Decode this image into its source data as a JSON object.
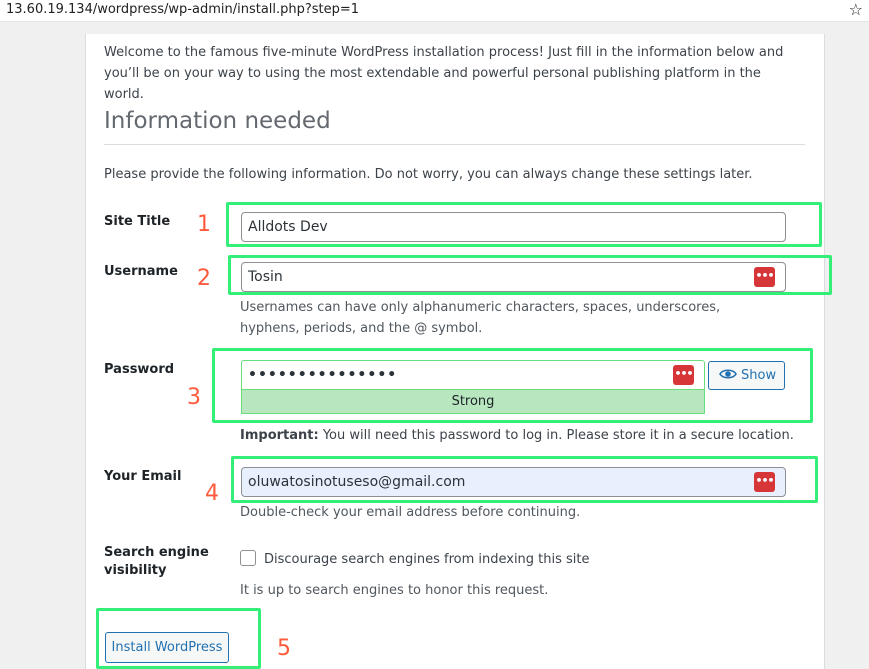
{
  "browser": {
    "url": "13.60.19.134/wordpress/wp-admin/install.php?step=1",
    "bookmark_icon": "star-icon"
  },
  "intro_text": "Welcome to the famous five-minute WordPress installation process! Just fill in the information below and you’ll be on your way to using the most extendable and powerful personal publishing platform in the world.",
  "heading": "Information needed",
  "provide_text": "Please provide the following information. Do not worry, you can always change these settings later.",
  "form": {
    "site_title": {
      "label": "Site Title",
      "value": "Alldots Dev"
    },
    "username": {
      "label": "Username",
      "value": "Tosin",
      "help": "Usernames can have only alphanumeric characters, spaces, underscores, hyphens, periods, and the @ symbol."
    },
    "password": {
      "label": "Password",
      "value": "•••••••••••••••",
      "show_label": "Show",
      "strength": "Strong",
      "important_label": "Important:",
      "important_text": " You will need this password to log in. Please store it in a secure location."
    },
    "email": {
      "label": "Your Email",
      "value": "oluwatosinotuseso@gmail.com",
      "help": "Double-check your email address before continuing."
    },
    "search_engine": {
      "label_line1": "Search engine",
      "label_line2": "visibility",
      "checkbox_label": "Discourage search engines from indexing this site",
      "checked": false,
      "help": "It is up to search engines to honor this request."
    },
    "install_button": "Install WordPress"
  },
  "annotations": [
    "1",
    "2",
    "3",
    "4",
    "5"
  ],
  "colors": {
    "annotation_box": "#33ee77",
    "annotation_number": "#ff5a3c",
    "wp_blue": "#2271b1",
    "strength_bg": "#b8e6bf",
    "password_manager": "#d63638"
  }
}
